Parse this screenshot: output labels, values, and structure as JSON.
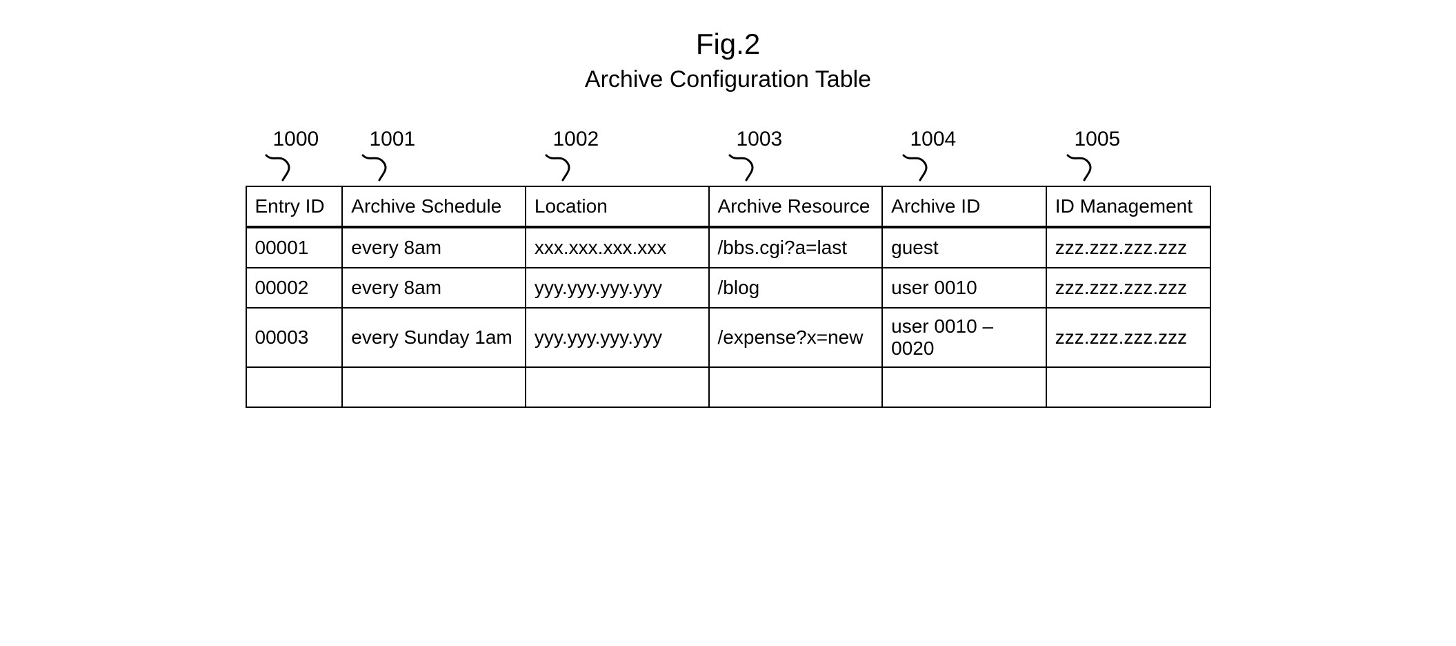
{
  "figure_label": "Fig.2",
  "title": "Archive Configuration Table",
  "column_refs": [
    "1000",
    "1001",
    "1002",
    "1003",
    "1004",
    "1005"
  ],
  "headers": {
    "c0": "Entry ID",
    "c1": "Archive Schedule",
    "c2": "Location",
    "c3": "Archive Resource",
    "c4": "Archive ID",
    "c5": "ID Management"
  },
  "rows": [
    {
      "c0": "00001",
      "c1": "every 8am",
      "c2": "xxx.xxx.xxx.xxx",
      "c3": "/bbs.cgi?a=last",
      "c4": "guest",
      "c5": "zzz.zzz.zzz.zzz"
    },
    {
      "c0": "00002",
      "c1": "every 8am",
      "c2": "yyy.yyy.yyy.yyy",
      "c3": "/blog",
      "c4": "user 0010",
      "c5": "zzz.zzz.zzz.zzz"
    },
    {
      "c0": "00003",
      "c1": "every Sunday 1am",
      "c2": "yyy.yyy.yyy.yyy",
      "c3": "/expense?x=new",
      "c4": "user 0010 – 0020",
      "c5": "zzz.zzz.zzz.zzz"
    },
    {
      "c0": "",
      "c1": "",
      "c2": "",
      "c3": "",
      "c4": "",
      "c5": ""
    }
  ]
}
